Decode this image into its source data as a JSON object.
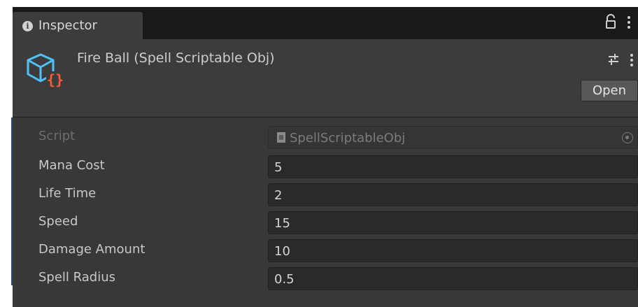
{
  "tab": {
    "label": "Inspector",
    "info_icon": "info-icon",
    "glyph": "i"
  },
  "tab_actions": {
    "lock_icon": "lock-icon",
    "menu_icon": "kebab-menu-icon"
  },
  "header": {
    "title": "Fire Ball (Spell Scriptable Obj)",
    "object_icon": "scriptable-object-icon",
    "preset_icon": "preset-sliders-icon",
    "menu_icon": "kebab-menu-icon",
    "open_label": "Open"
  },
  "script_row": {
    "label": "Script",
    "value": "SpellScriptableObj",
    "file_icon": "script-file-icon",
    "picker_icon": "object-picker-icon"
  },
  "fields": [
    {
      "label": "Mana Cost",
      "value": "5"
    },
    {
      "label": "Life Time",
      "value": "2"
    },
    {
      "label": "Speed",
      "value": "15"
    },
    {
      "label": "Damage Amount",
      "value": "10"
    },
    {
      "label": "Spell Radius",
      "value": "0.5"
    }
  ],
  "colors": {
    "panel_bg": "#383838",
    "header_bg": "#3c3c3c",
    "tabbar_bg": "#191919",
    "icon_cyan": "#4fc3f7",
    "icon_braces_orange": "#ff5a36"
  }
}
